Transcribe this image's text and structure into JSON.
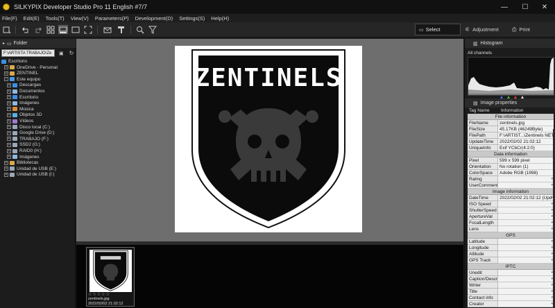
{
  "titlebar": {
    "title": "SILKYPIX Developer Studio Pro 11 English  #7/7",
    "minimize": "—",
    "maximize": "☐",
    "close": "✕"
  },
  "menu": [
    "File(F)",
    "Edit(E)",
    "Tools(T)",
    "View(V)",
    "Parameters(P)",
    "Development(D)",
    "Settings(S)",
    "Help(H)"
  ],
  "toolbar": {
    "select_label": "Select",
    "adjustment_label": "Adjustment",
    "print_label": "Print"
  },
  "left_panel": {
    "header": "Folder",
    "path": "F:\\ARTISTA TRABAJO\\Ze",
    "tree": [
      {
        "label": "Escritorio",
        "indent": 0,
        "expander": "",
        "icon_color": "#3a8ee6",
        "selected": false
      },
      {
        "label": "OneDrive - Personal",
        "indent": 1,
        "expander": "+",
        "icon_color": "#d9a94a",
        "selected": false
      },
      {
        "label": "ZENTINEL",
        "indent": 1,
        "expander": "+",
        "icon_color": "#d9a94a",
        "selected": false
      },
      {
        "label": "Este equipo",
        "indent": 1,
        "expander": "−",
        "icon_color": "#4a9ae6",
        "selected": false
      },
      {
        "label": "Descargas",
        "indent": 2,
        "expander": "+",
        "icon_color": "#3a8ee6",
        "selected": false
      },
      {
        "label": "Documentos",
        "indent": 2,
        "expander": "+",
        "icon_color": "#8fb8e0",
        "selected": false
      },
      {
        "label": "Escritorio",
        "indent": 2,
        "expander": "+",
        "icon_color": "#3a8ee6",
        "selected": false
      },
      {
        "label": "Imágenes",
        "indent": 2,
        "expander": "+",
        "icon_color": "#8fb8e0",
        "selected": false
      },
      {
        "label": "Música",
        "indent": 2,
        "expander": "+",
        "icon_color": "#e08a3a",
        "selected": false
      },
      {
        "label": "Objetos 3D",
        "indent": 2,
        "expander": "+",
        "icon_color": "#5ab0e6",
        "selected": false
      },
      {
        "label": "Vídeos",
        "indent": 2,
        "expander": "+",
        "icon_color": "#a07ad0",
        "selected": false
      },
      {
        "label": "Disco local (C:)",
        "indent": 2,
        "expander": "+",
        "icon_color": "#9aa8b8",
        "selected": false
      },
      {
        "label": "Google Drive (D:)",
        "indent": 2,
        "expander": "+",
        "icon_color": "#9aa8b8",
        "selected": false
      },
      {
        "label": "TRABAJO (F:)",
        "indent": 2,
        "expander": "+",
        "icon_color": "#9aa8b8",
        "selected": false
      },
      {
        "label": "SSD2 (G:)",
        "indent": 2,
        "expander": "+",
        "icon_color": "#9aa8b8",
        "selected": false
      },
      {
        "label": "RAID0 (H:)",
        "indent": 2,
        "expander": "+",
        "icon_color": "#9aa8b8",
        "selected": false
      },
      {
        "label": "Imágenes",
        "indent": 2,
        "expander": "+",
        "icon_color": "#8fb8e0",
        "selected": false
      },
      {
        "label": "Bibliotecas",
        "indent": 1,
        "expander": "+",
        "icon_color": "#d9a94a",
        "selected": false
      },
      {
        "label": "Unidad de USB (E:)",
        "indent": 1,
        "expander": "+",
        "icon_color": "#9aa8b8",
        "selected": false
      },
      {
        "label": "Unidad de USB (I:)",
        "indent": 1,
        "expander": "+",
        "icon_color": "#9aa8b8",
        "selected": false
      }
    ]
  },
  "preview": {
    "logo_text": "ZENTINELS"
  },
  "filmstrip": {
    "items": [
      {
        "filename": "zentinels.jpg",
        "date": "2022/02/02 21:02:12",
        "stars": "☆☆☆☆☆"
      }
    ]
  },
  "histogram": {
    "header": "Histogram",
    "channel": "All channels"
  },
  "image_properties": {
    "header": "Image properties",
    "col_tag": "Tag Name",
    "col_info": "Information",
    "sections": [
      {
        "title": "File information",
        "rows": [
          {
            "key": "FileName",
            "value": "zentinels.jpg",
            "dropdown": false
          },
          {
            "key": "FileSize",
            "value": "45.17KB (46249Byte)",
            "dropdown": false
          },
          {
            "key": "FilePath",
            "value": "F:\\ARTIST...\\Zentinels NET",
            "dropdown": false
          },
          {
            "key": "UpdateTime",
            "value": "2022/02/02 21:02:12",
            "dropdown": false
          },
          {
            "key": "UniqueInfo",
            "value": "Exif YCbCr(4:2:0)",
            "dropdown": false
          }
        ]
      },
      {
        "title": "Data information",
        "rows": [
          {
            "key": "Pixel",
            "value": "599 x 599 pixel",
            "dropdown": false
          },
          {
            "key": "Orientation",
            "value": "No rotation (1)",
            "dropdown": false
          },
          {
            "key": "ColorSpace",
            "value": "Adobe RGB (1998)",
            "dropdown": false
          },
          {
            "key": "Rating",
            "value": "",
            "dropdown": true
          },
          {
            "key": "UserComment",
            "value": "",
            "dropdown": true
          }
        ]
      },
      {
        "title": "Image information",
        "rows": [
          {
            "key": "DateTime",
            "value": "2022/02/02 21:02:12 (Upd",
            "dropdown": true
          },
          {
            "key": "ISO Speed",
            "value": "",
            "dropdown": true
          },
          {
            "key": "ShutterSpeed",
            "value": "",
            "dropdown": true
          },
          {
            "key": "ApertureVal",
            "value": "",
            "dropdown": true
          },
          {
            "key": "FocalLength",
            "value": "",
            "dropdown": true
          },
          {
            "key": "Lens",
            "value": "",
            "dropdown": true
          }
        ]
      },
      {
        "title": "GPS",
        "rows": [
          {
            "key": "Latitude",
            "value": "",
            "dropdown": true
          },
          {
            "key": "Longitude",
            "value": "",
            "dropdown": true
          },
          {
            "key": "Altitude",
            "value": "",
            "dropdown": true
          },
          {
            "key": "GPS Track",
            "value": "",
            "dropdown": true
          }
        ]
      },
      {
        "title": "IPTC",
        "rows": [
          {
            "key": "Unedit",
            "value": "",
            "dropdown": true
          },
          {
            "key": "Caption/Descri",
            "value": "",
            "dropdown": true
          },
          {
            "key": "Writer",
            "value": "",
            "dropdown": true
          },
          {
            "key": "Title",
            "value": "",
            "dropdown": true
          },
          {
            "key": "Contact info",
            "value": "",
            "dropdown": true
          },
          {
            "key": "Creator",
            "value": "",
            "dropdown": true
          }
        ]
      }
    ]
  }
}
